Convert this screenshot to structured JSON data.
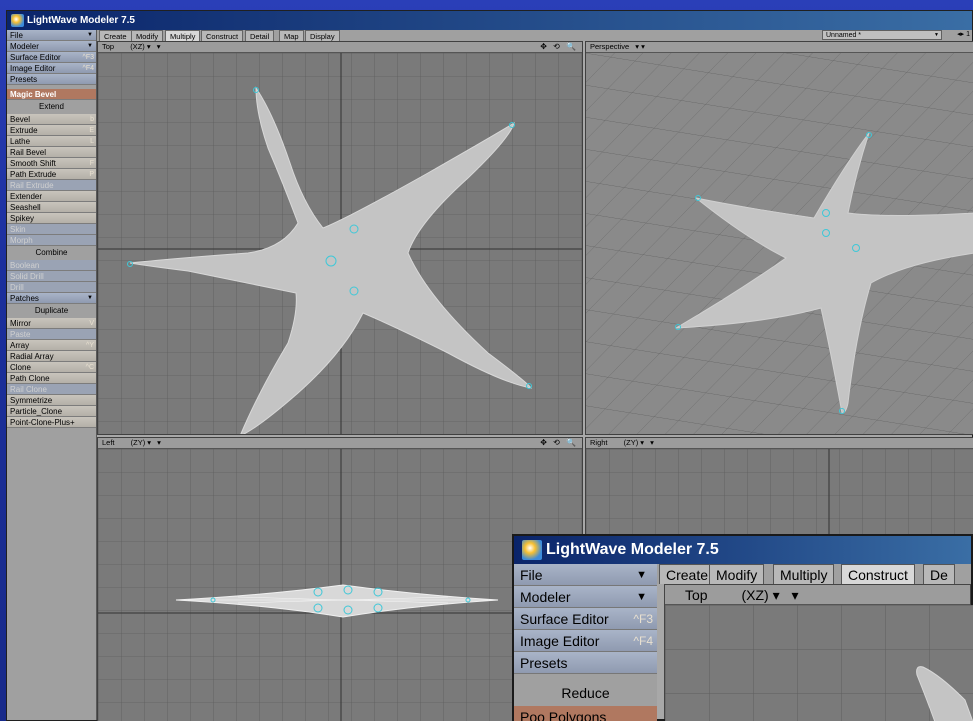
{
  "window": {
    "title": "LightWave Modeler 7.5"
  },
  "left_panel": {
    "top_rows": [
      {
        "label": "File",
        "dropdown": true
      },
      {
        "label": "Modeler",
        "dropdown": true
      },
      {
        "label": "Surface Editor",
        "hotkey": "^F3"
      },
      {
        "label": "Image Editor",
        "hotkey": "^F4"
      },
      {
        "label": "Presets"
      }
    ],
    "magic_bevel": "Magic Bevel",
    "extend_header": "Extend",
    "extend_items": [
      {
        "label": "Bevel",
        "hotkey": "b"
      },
      {
        "label": "Extrude",
        "hotkey": "E"
      },
      {
        "label": "Lathe",
        "hotkey": "L"
      },
      {
        "label": "Rail Bevel"
      },
      {
        "label": "Smooth Shift",
        "hotkey": "F"
      },
      {
        "label": "Path Extrude",
        "hotkey": "P"
      },
      {
        "label": "Rail Extrude",
        "disabled": true
      },
      {
        "label": "Extender"
      },
      {
        "label": "Seashell"
      },
      {
        "label": "Spikey"
      },
      {
        "label": "Skin",
        "disabled": true
      },
      {
        "label": "Morph",
        "disabled": true
      }
    ],
    "combine_header": "Combine",
    "combine_items": [
      {
        "label": "Boolean",
        "disabled": true
      },
      {
        "label": "Solid Drill",
        "disabled": true
      },
      {
        "label": "Drill",
        "disabled": true
      },
      {
        "label": "Patches",
        "dropdown": true
      }
    ],
    "duplicate_header": "Duplicate",
    "duplicate_items": [
      {
        "label": "Mirror",
        "hotkey": "V"
      },
      {
        "label": "Paste",
        "disabled": true
      },
      {
        "label": "Array",
        "hotkey": "^Y"
      },
      {
        "label": "Radial Array"
      },
      {
        "label": "Clone",
        "hotkey": "^C"
      },
      {
        "label": "Path Clone"
      },
      {
        "label": "Rail Clone",
        "disabled": true
      },
      {
        "label": "Symmetrize"
      },
      {
        "label": "Particle_Clone"
      },
      {
        "label": "Point-Clone-Plus+"
      }
    ]
  },
  "tabs": [
    "Create",
    "Modify",
    "Multiply",
    "Construct",
    "Detail",
    "Map",
    "Display"
  ],
  "active_tab": "Multiply",
  "document": {
    "name": "Unnamed *",
    "layer_label": "1"
  },
  "viewports": {
    "top": {
      "label": "Top",
      "axis": "(XZ)"
    },
    "perspective": {
      "label": "Perspective"
    },
    "left": {
      "label": "Left",
      "axis": "(ZY)"
    },
    "right": {
      "label": "Right",
      "axis": "(ZY)"
    }
  },
  "tool_glyphs": "✥ ⟲ 🔍",
  "zoom_window": {
    "title": "LightWave Modeler 7.5",
    "rows": [
      {
        "label": "File",
        "dropdown": true
      },
      {
        "label": "Modeler",
        "dropdown": true
      },
      {
        "label": "Surface Editor",
        "hotkey": "^F3"
      },
      {
        "label": "Image Editor",
        "hotkey": "^F4"
      },
      {
        "label": "Presets"
      }
    ],
    "reduce_header": "Reduce",
    "partial_row": "Poo Polygons",
    "tabs": [
      "Create",
      "Modify",
      "Multiply",
      "Construct",
      "De"
    ],
    "active_tab": "Construct",
    "viewport_label": "Top",
    "viewport_axis": "(XZ)"
  },
  "colors": {
    "accent_vertex": "#3ec8d8",
    "mesh_fill": "#c8c8c8",
    "grid_bg": "#7a7a7a",
    "title_start": "#0a246a",
    "title_end": "#3a6ea5"
  }
}
